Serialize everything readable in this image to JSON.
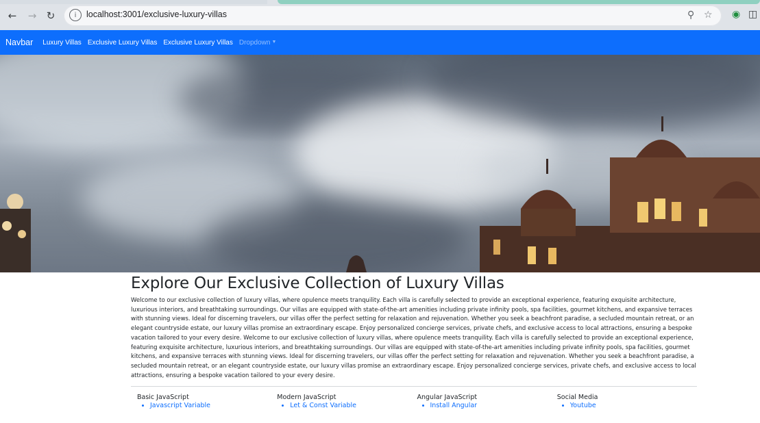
{
  "browser": {
    "url": "localhost:3001/exclusive-luxury-villas",
    "icons": [
      "back-icon",
      "forward-icon",
      "reload-icon",
      "site-info-icon",
      "zoom-icon",
      "bookmark-star-icon",
      "extension-icon",
      "profile-icon"
    ]
  },
  "navbar": {
    "brand": "Navbar",
    "links": [
      "Luxury Villas",
      "Exclusive Luxury Villas",
      "Exclusive Luxury Villas"
    ],
    "dropdown": "Dropdown",
    "accent": "#0d6efd"
  },
  "main": {
    "title": "Explore Our Exclusive Collection of Luxury Villas",
    "paragraph": "Welcome to our exclusive collection of luxury villas, where opulence meets tranquility. Each villa is carefully selected to provide an exceptional experience, featuring exquisite architecture, luxurious interiors, and breathtaking surroundings. Our villas are equipped with state-of-the-art amenities including private infinity pools, spa facilities, gourmet kitchens, and expansive terraces with stunning views. Ideal for discerning travelers, our villas offer the perfect setting for relaxation and rejuvenation. Whether you seek a beachfront paradise, a secluded mountain retreat, or an elegant countryside estate, our luxury villas promise an extraordinary escape. Enjoy personalized concierge services, private chefs, and exclusive access to local attractions, ensuring a bespoke vacation tailored to your every desire. Welcome to our exclusive collection of luxury villas, where opulence meets tranquility. Each villa is carefully selected to provide an exceptional experience, featuring exquisite architecture, luxurious interiors, and breathtaking surroundings. Our villas are equipped with state-of-the-art amenities including private infinity pools, spa facilities, gourmet kitchens, and expansive terraces with stunning views. Ideal for discerning travelers, our villas offer the perfect setting for relaxation and rejuvenation. Whether you seek a beachfront paradise, a secluded mountain retreat, or an elegant countryside estate, our luxury villas promise an extraordinary escape. Enjoy personalized concierge services, private chefs, and exclusive access to local attractions, ensuring a bespoke vacation tailored to your every desire."
  },
  "footer": {
    "columns": [
      {
        "title": "Basic JavaScript",
        "link": "Javascript Variable"
      },
      {
        "title": "Modern JavaScript",
        "link": "Let & Const Variable"
      },
      {
        "title": "Angular JavaScript",
        "link": "Install Angular"
      },
      {
        "title": "Social Media",
        "link": "Youtube"
      }
    ]
  }
}
